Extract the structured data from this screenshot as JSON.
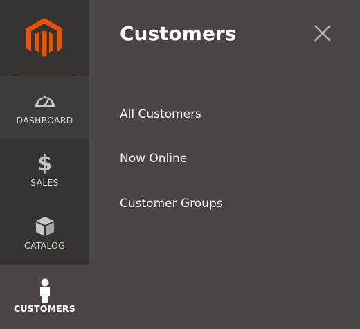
{
  "sidebar": {
    "logo_icon": "magento-logo-icon",
    "items": [
      {
        "label": "DASHBOARD",
        "icon": "gauge-icon"
      },
      {
        "label": "SALES",
        "icon": "dollar-icon"
      },
      {
        "label": "CATALOG",
        "icon": "box-icon"
      },
      {
        "label": "CUSTOMERS",
        "icon": "person-icon",
        "active": true
      }
    ]
  },
  "panel": {
    "title": "Customers",
    "close_icon": "close-icon",
    "links": [
      "All Customers",
      "Now Online",
      "Customer Groups"
    ]
  },
  "colors": {
    "brand_orange": "#eb5202",
    "sidebar_bg": "#373330",
    "panel_bg": "#4a4542"
  }
}
